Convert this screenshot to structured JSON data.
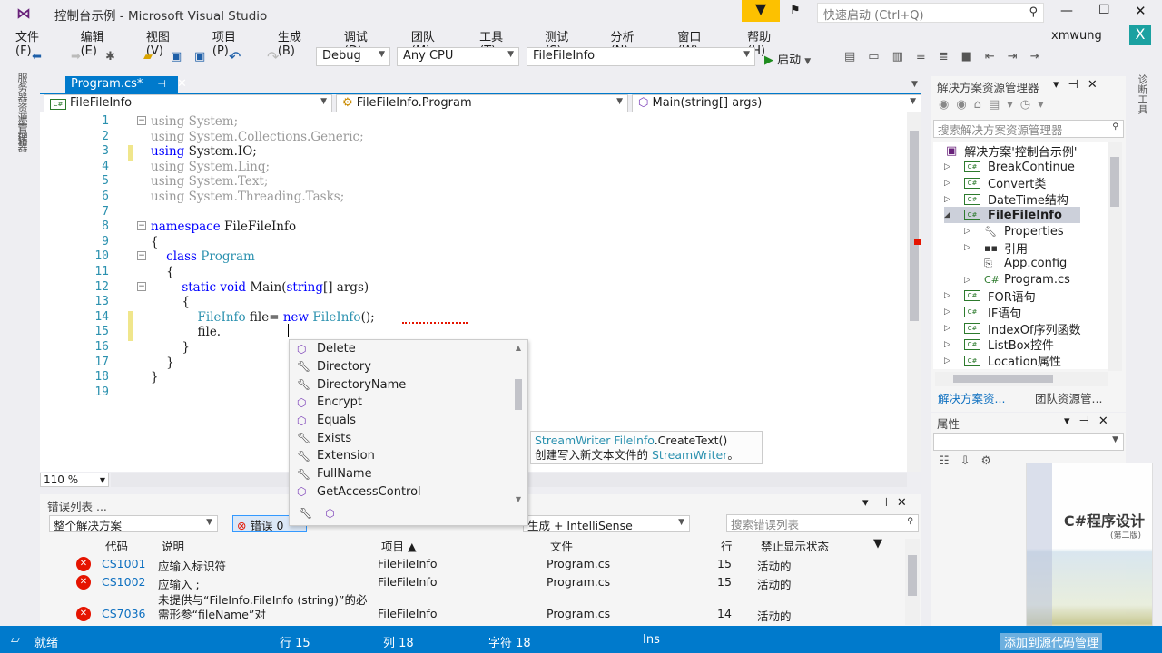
{
  "window": {
    "title": "控制台示例 - Microsoft Visual Studio",
    "quick_launch_placeholder": "快速启动 (Ctrl+Q)",
    "user": "xmwung",
    "user_badge": "X"
  },
  "menu": [
    "文件(F)",
    "编辑(E)",
    "视图(V)",
    "项目(P)",
    "生成(B)",
    "调试(D)",
    "团队(M)",
    "工具(T)",
    "测试(S)",
    "分析(N)",
    "窗口(W)",
    "帮助(H)"
  ],
  "toolbar": {
    "config": "Debug",
    "platform": "Any CPU",
    "startup_project": "FileFileInfo",
    "start_label": "启动"
  },
  "left_strip": {
    "server_explorer": "服务器资源管理器",
    "toolbox": "工具箱"
  },
  "right_strip": {
    "diagnostics": "诊断工具"
  },
  "editor": {
    "tab": "Program.cs*",
    "nav_project": "FileFileInfo",
    "nav_class": "FileFileInfo.Program",
    "nav_member": "Main(string[] args)",
    "zoom": "110 %",
    "lines": [
      [
        {
          "t": "using System;",
          "c": "gr"
        }
      ],
      [
        {
          "t": "using System.Collections.Generic;",
          "c": "gr"
        }
      ],
      [
        {
          "t": "using",
          "c": "kw"
        },
        {
          "t": " System.IO;",
          "c": ""
        }
      ],
      [
        {
          "t": "using System.Linq;",
          "c": "gr"
        }
      ],
      [
        {
          "t": "using System.Text;",
          "c": "gr"
        }
      ],
      [
        {
          "t": "using System.Threading.Tasks;",
          "c": "gr"
        }
      ],
      [],
      [
        {
          "t": "namespace",
          "c": "kw"
        },
        {
          "t": " FileFileInfo",
          "c": ""
        }
      ],
      [
        {
          "t": "{",
          "c": ""
        }
      ],
      [
        {
          "t": "    class",
          "c": "kw"
        },
        {
          "t": " ",
          "c": ""
        },
        {
          "t": "Program",
          "c": "ty"
        }
      ],
      [
        {
          "t": "    {",
          "c": ""
        }
      ],
      [
        {
          "t": "        static void",
          "c": "kw"
        },
        {
          "t": " Main(",
          "c": ""
        },
        {
          "t": "string",
          "c": "kw"
        },
        {
          "t": "[] args)",
          "c": ""
        }
      ],
      [
        {
          "t": "        {",
          "c": ""
        }
      ],
      [
        {
          "t": "            FileInfo",
          "c": "ty"
        },
        {
          "t": " file= ",
          "c": ""
        },
        {
          "t": "new",
          "c": "kw"
        },
        {
          "t": " ",
          "c": ""
        },
        {
          "t": "FileInfo",
          "c": "ty"
        },
        {
          "t": "();",
          "c": ""
        }
      ],
      [
        {
          "t": "            file.",
          "c": ""
        }
      ],
      [
        {
          "t": "        }",
          "c": ""
        }
      ],
      [
        {
          "t": "    }",
          "c": ""
        }
      ],
      [
        {
          "t": "}",
          "c": ""
        }
      ],
      []
    ]
  },
  "completion": {
    "items": [
      {
        "label": "Delete",
        "icon": "method-icon"
      },
      {
        "label": "Directory",
        "icon": "property-icon"
      },
      {
        "label": "DirectoryName",
        "icon": "property-icon"
      },
      {
        "label": "Encrypt",
        "icon": "method-icon"
      },
      {
        "label": "Equals",
        "icon": "method-icon"
      },
      {
        "label": "Exists",
        "icon": "property-icon"
      },
      {
        "label": "Extension",
        "icon": "property-icon"
      },
      {
        "label": "FullName",
        "icon": "property-icon"
      },
      {
        "label": "GetAccessControl",
        "icon": "method-icon"
      }
    ],
    "tooltip_sig_type": "StreamWriter FileInfo",
    "tooltip_sig_rest": ".CreateText()",
    "tooltip_desc": "创建写入新文本文件的 ",
    "tooltip_desc_link": "StreamWriter",
    "tooltip_desc_end": "。"
  },
  "error_list": {
    "title": "错误列表 ...",
    "scope": "整个解决方案",
    "errors_btn": "错误 0",
    "source": "生成 + IntelliSense",
    "search_placeholder": "搜索错误列表",
    "columns": [
      "代码",
      "说明",
      "项目 ▲",
      "文件",
      "行",
      "禁止显示状态"
    ],
    "rows": [
      {
        "code": "CS1001",
        "desc": "应输入标识符",
        "project": "FileFileInfo",
        "file": "Program.cs",
        "line": "15",
        "state": "活动的"
      },
      {
        "code": "CS1002",
        "desc": "应输入 ;",
        "project": "FileFileInfo",
        "file": "Program.cs",
        "line": "15",
        "state": "活动的"
      },
      {
        "code": "CS7036",
        "desc": "未提供与“FileInfo.FileInfo (string)”的必需形参“fileName”对",
        "project": "FileFileInfo",
        "file": "Program.cs",
        "line": "14",
        "state": "活动的"
      }
    ]
  },
  "solution_explorer": {
    "title": "解决方案资源管理器",
    "search_placeholder": "搜索解决方案资源管理器",
    "solution": "解决方案'控制台示例'",
    "items": [
      {
        "label": "BreakContinue",
        "level": 0,
        "bold": false
      },
      {
        "label": "Convert类",
        "level": 0
      },
      {
        "label": "DateTime结构",
        "level": 0
      },
      {
        "label": "FileFileInfo",
        "level": 0,
        "bold": true,
        "selected": true
      },
      {
        "label": "Properties",
        "level": 1
      },
      {
        "label": "引用",
        "level": 1
      },
      {
        "label": "App.config",
        "level": 1
      },
      {
        "label": "Program.cs",
        "level": 1
      },
      {
        "label": "FOR语句",
        "level": 0
      },
      {
        "label": "IF语句",
        "level": 0
      },
      {
        "label": "IndexOf序列函数",
        "level": 0
      },
      {
        "label": "ListBox控件",
        "level": 0
      },
      {
        "label": "Location属性",
        "level": 0
      }
    ],
    "tab1": "解决方案资...",
    "tab2": "团队资源管..."
  },
  "properties": {
    "title": "属性"
  },
  "book": {
    "title": "C#程序设计",
    "edition": "(第二版)"
  },
  "status": {
    "ready": "就绪",
    "line": "行 15",
    "col": "列 18",
    "char": "字符 18",
    "mode": "Ins",
    "source_control": "添加到源代码管理"
  },
  "colors": {
    "accent": "#007acc",
    "error": "#e51400"
  }
}
